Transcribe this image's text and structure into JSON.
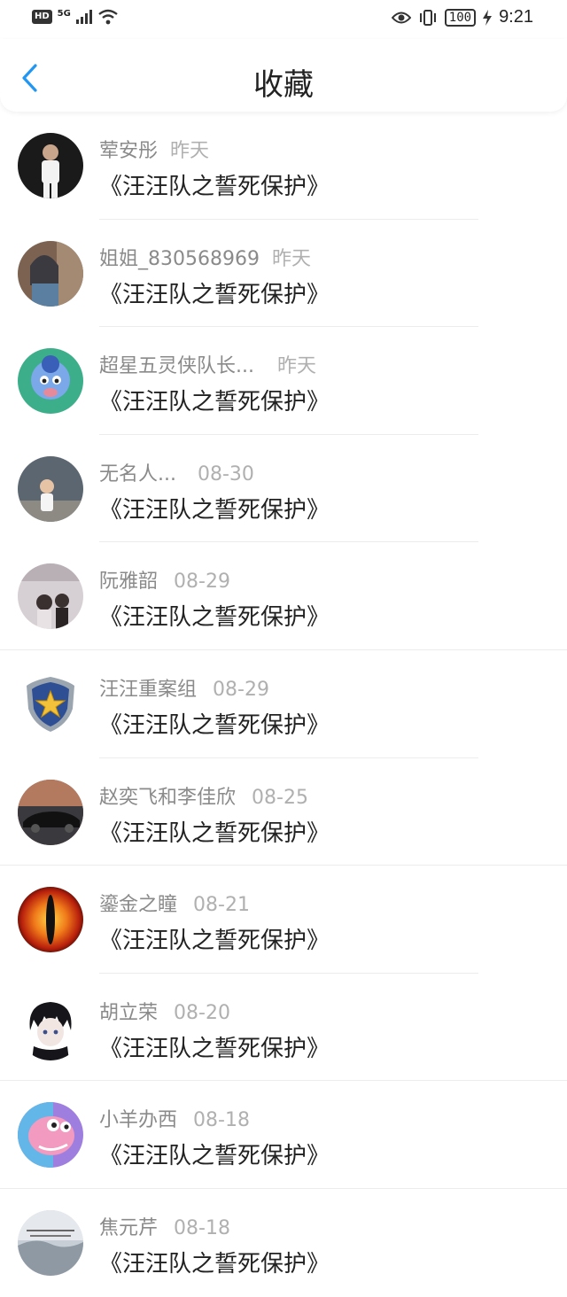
{
  "status_bar": {
    "hd": "HD",
    "network": "5G",
    "battery": "100",
    "time": "9:21"
  },
  "header": {
    "title": "收藏"
  },
  "items": [
    {
      "name": "荤安彤",
      "time": "昨天",
      "title": "《汪汪队之誓死保护》"
    },
    {
      "name": "姐姐_830568969",
      "time": "昨天",
      "title": "《汪汪队之誓死保护》"
    },
    {
      "name": "超星五灵侠队长...",
      "time": "昨天",
      "title": "《汪汪队之誓死保护》"
    },
    {
      "name": "无名人...",
      "time": "08-30",
      "title": "《汪汪队之誓死保护》"
    },
    {
      "name": "阮雅韶",
      "time": "08-29",
      "title": "《汪汪队之誓死保护》"
    },
    {
      "name": "汪汪重案组",
      "time": "08-29",
      "title": "《汪汪队之誓死保护》"
    },
    {
      "name": "赵奕飞和李佳欣",
      "time": "08-25",
      "title": "《汪汪队之誓死保护》"
    },
    {
      "name": "鎏金之瞳",
      "time": "08-21",
      "title": "《汪汪队之誓死保护》"
    },
    {
      "name": "胡立荣",
      "time": "08-20",
      "title": "《汪汪队之誓死保护》"
    },
    {
      "name": "小羊办西",
      "time": "08-18",
      "title": "《汪汪队之誓死保护》"
    },
    {
      "name": "焦元芹",
      "time": "08-18",
      "title": "《汪汪队之誓死保护》"
    }
  ],
  "colors": {
    "accent": "#2196f3",
    "name": "#8a8a8a",
    "time": "#b0b0b0",
    "title": "#222222"
  }
}
